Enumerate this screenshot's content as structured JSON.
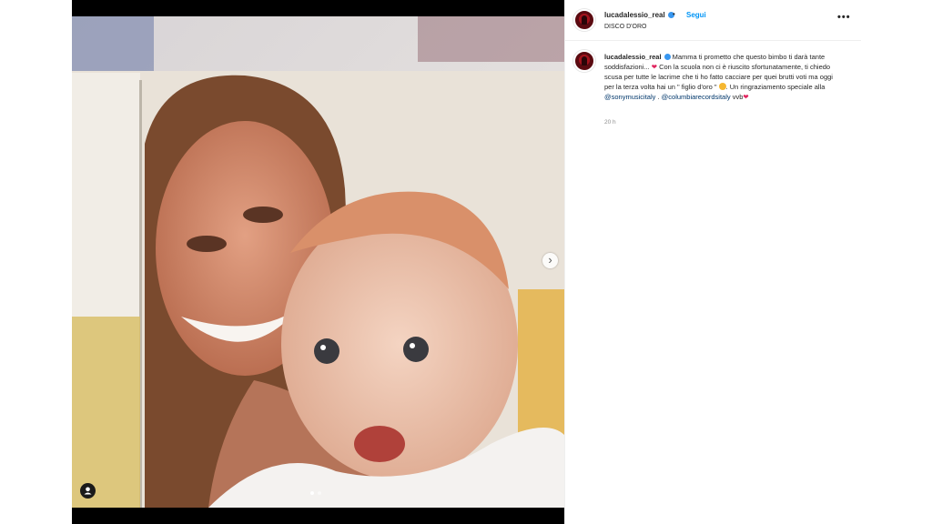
{
  "post": {
    "username": "lucadalessio_real",
    "separator": "•",
    "follow_label": "Segui",
    "subtitle": "DISCO D'ORO",
    "more_icon": "•••",
    "carousel_next_icon": "›"
  },
  "caption": {
    "username": "lucadalessio_real",
    "part1": "Mamma ti prometto che questo bimbo ti darà tante soddisfazioni... ",
    "heart1": "❤",
    "part2": " Con la scuola non ci è riuscito sfortunatamente, ti chiedo scusa per tutte le lacrime che ti ho fatto cacciare per quei brutti voti ma oggi per la terza volta hai un \" figlio d'oro \"",
    "part3": ". Un ringraziamento speciale alla ",
    "mention1": "@sonymusicitaly",
    "between": " . ",
    "mention2": "@columbiarecordsitaly",
    "part4": " vvb",
    "heart2": "❤",
    "time": "20 h"
  },
  "colors": {
    "follow": "#0095f6",
    "verified": "#3897f0",
    "heart": "#e0245e",
    "mention": "#00376b"
  }
}
